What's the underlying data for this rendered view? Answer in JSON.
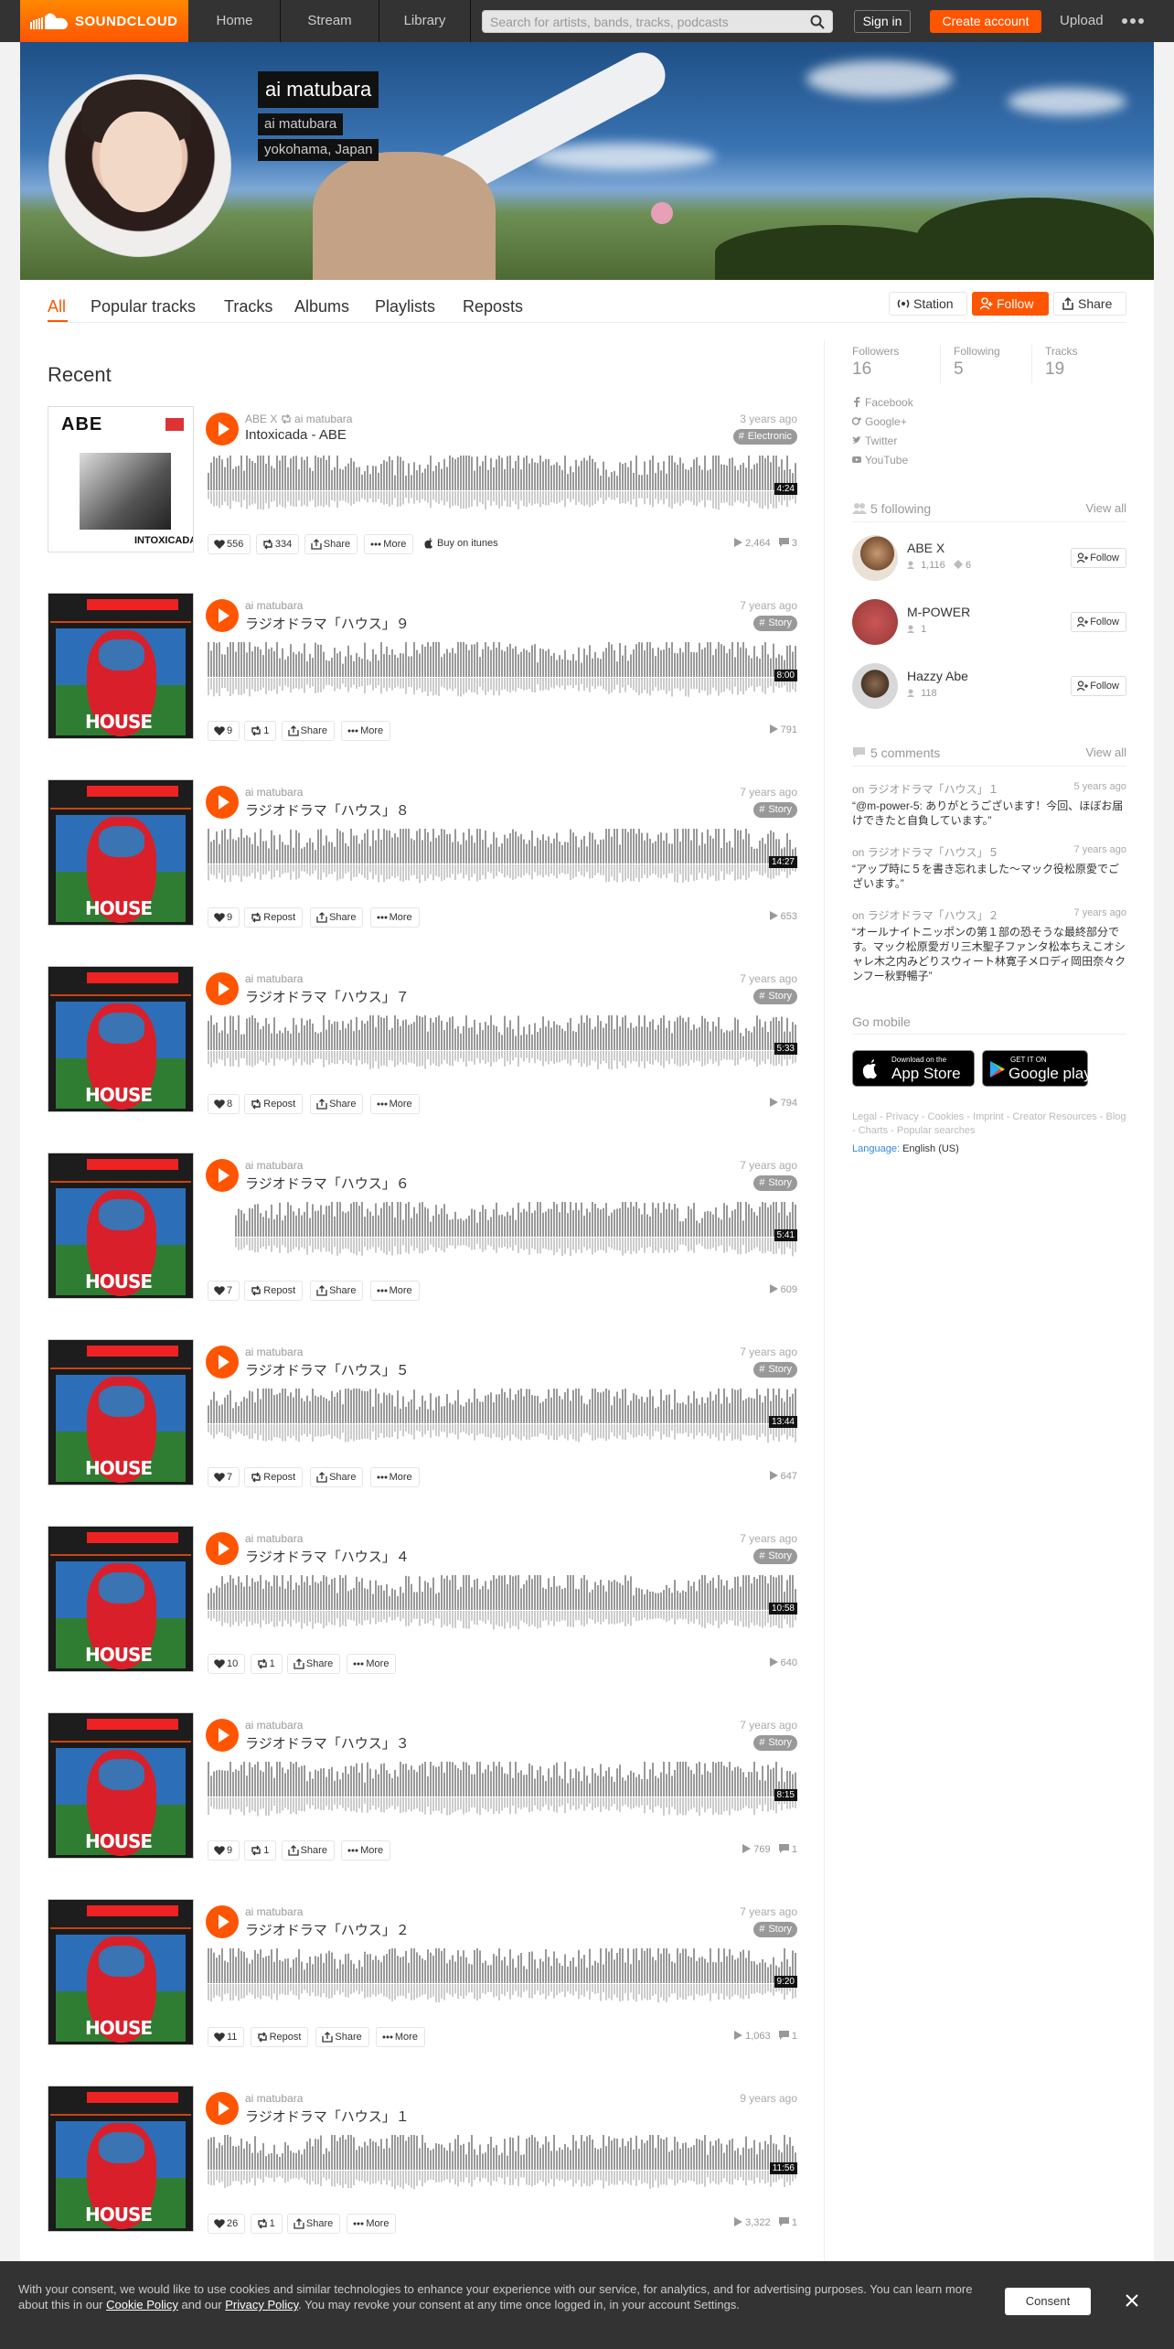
{
  "header": {
    "brand": "SOUNDCLOUD",
    "nav": [
      "Home",
      "Stream",
      "Library"
    ],
    "search_placeholder": "Search for artists, bands, tracks, podcasts",
    "signin": "Sign in",
    "create": "Create account",
    "upload": "Upload"
  },
  "profile": {
    "name": "ai matubara",
    "username": "ai matubara",
    "location": "yokohama, Japan"
  },
  "tabs": [
    "All",
    "Popular tracks",
    "Tracks",
    "Albums",
    "Playlists",
    "Reposts"
  ],
  "actions": {
    "station": "Station",
    "follow": "Follow",
    "share": "Share"
  },
  "recent_title": "Recent",
  "tracks": [
    {
      "user": "ABE X",
      "repost_by": "ai matubara",
      "title": "Intoxicada - ABE",
      "ago": "3 years ago",
      "genre": "Electronic",
      "duration": "4:24",
      "likes": "556",
      "reposts": "334",
      "share": "Share",
      "more": "More",
      "itunes": "Buy on itunes",
      "plays": "2,464",
      "comments": "3"
    },
    {
      "user": "ai matubara",
      "title": "ラジオドラマ「ハウス」９",
      "ago": "7 years ago",
      "genre": "Story",
      "duration": "8:00",
      "likes": "9",
      "reposts": "1",
      "share": "Share",
      "more": "More",
      "plays": "791",
      "comments": ""
    },
    {
      "user": "ai matubara",
      "title": "ラジオドラマ「ハウス」８",
      "ago": "7 years ago",
      "genre": "Story",
      "duration": "14:27",
      "likes": "9",
      "reposts": "Repost",
      "share": "Share",
      "more": "More",
      "plays": "653",
      "comments": ""
    },
    {
      "user": "ai matubara",
      "title": "ラジオドラマ「ハウス」７",
      "ago": "7 years ago",
      "genre": "Story",
      "duration": "5:33",
      "likes": "8",
      "reposts": "Repost",
      "share": "Share",
      "more": "More",
      "plays": "794",
      "comments": ""
    },
    {
      "user": "ai matubara",
      "title": "ラジオドラマ「ハウス」６",
      "ago": "7 years ago",
      "genre": "Story",
      "duration": "5:41",
      "likes": "7",
      "reposts": "Repost",
      "share": "Share",
      "more": "More",
      "plays": "609",
      "comments": ""
    },
    {
      "user": "ai matubara",
      "title": "ラジオドラマ「ハウス」５",
      "ago": "7 years ago",
      "genre": "Story",
      "duration": "13:44",
      "likes": "7",
      "reposts": "Repost",
      "share": "Share",
      "more": "More",
      "plays": "647",
      "comments": ""
    },
    {
      "user": "ai matubara",
      "title": "ラジオドラマ「ハウス」４",
      "ago": "7 years ago",
      "genre": "Story",
      "duration": "10:58",
      "likes": "10",
      "reposts": "1",
      "share": "Share",
      "more": "More",
      "plays": "640",
      "comments": ""
    },
    {
      "user": "ai matubara",
      "title": "ラジオドラマ「ハウス」３",
      "ago": "7 years ago",
      "genre": "Story",
      "duration": "8:15",
      "likes": "9",
      "reposts": "1",
      "share": "Share",
      "more": "More",
      "plays": "769",
      "comments": "1"
    },
    {
      "user": "ai matubara",
      "title": "ラジオドラマ「ハウス」２",
      "ago": "7 years ago",
      "genre": "Story",
      "duration": "9:20",
      "likes": "11",
      "reposts": "Repost",
      "share": "Share",
      "more": "More",
      "plays": "1,063",
      "comments": "1"
    },
    {
      "user": "ai matubara",
      "title": "ラジオドラマ「ハウス」１",
      "ago": "9 years ago",
      "genre": "",
      "duration": "11:56",
      "likes": "26",
      "reposts": "1",
      "share": "Share",
      "more": "More",
      "plays": "3,322",
      "comments": "1"
    }
  ],
  "sidebar": {
    "stats": [
      {
        "label": "Followers",
        "value": "16"
      },
      {
        "label": "Following",
        "value": "5"
      },
      {
        "label": "Tracks",
        "value": "19"
      }
    ],
    "social": [
      "Facebook",
      "Google+",
      "Twitter",
      "YouTube"
    ],
    "following_header": "5 following",
    "view_all": "View all",
    "following": [
      {
        "name": "ABE X",
        "followers": "1,116",
        "tracks": "6",
        "follow": "Follow"
      },
      {
        "name": "M-POWER",
        "followers": "1",
        "tracks": "",
        "follow": "Follow"
      },
      {
        "name": "Hazzy Abe",
        "followers": "118",
        "tracks": "",
        "follow": "Follow"
      }
    ],
    "comments_header": "5 comments",
    "comments": [
      {
        "on": "on",
        "track": "ラジオドラマ「ハウス」１",
        "ago": "5 years ago",
        "text": "“@m-power-5: ありがとうございます！今回、ほぼお届けできたと自負しています。”"
      },
      {
        "on": "on",
        "track": "ラジオドラマ「ハウス」５",
        "ago": "7 years ago",
        "text": "“アップ時に５を書き忘れました〜マック役松原愛でございます。”"
      },
      {
        "on": "on",
        "track": "ラジオドラマ「ハウス」２",
        "ago": "7 years ago",
        "text": "“オールナイトニッポンの第１部の恐そうな最終部分です。マック松原愛ガリ三木聖子ファンタ松本ちえこオシャレ木之内みどりスウィート林寛子メロディ岡田奈々クンフー秋野暢子”"
      }
    ],
    "go_mobile": "Go mobile",
    "appstore_small": "Download on the",
    "appstore_big": "App Store",
    "gplay_small": "GET IT ON",
    "gplay_big": "Google play",
    "footer_links": "Legal - Privacy - Cookies - Imprint - Creator Resources - Blog - Charts - Popular searches",
    "language_label": "Language:",
    "language_value": "English (US)"
  },
  "cookie": {
    "text_a": "With your consent, we would like to use cookies and similar technologies to enhance your experience with our service, for analytics, and for advertising purposes. You can learn more about this in our ",
    "cookie_policy": "Cookie Policy",
    "and": " and our ",
    "privacy_policy": "Privacy Policy",
    "text_b": ". You may revoke your consent at any time once logged in, in your account Settings.",
    "consent": "Consent"
  }
}
